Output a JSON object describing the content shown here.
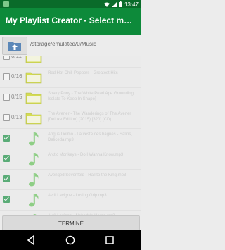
{
  "status_bar": {
    "time": "13:47"
  },
  "app_bar": {
    "title": "My Playlist Creator - Select music..."
  },
  "path_bar": {
    "path": "/storage/emulated/0/Music"
  },
  "rows": [
    {
      "type": "folder",
      "checked": false,
      "count": "0/11",
      "name": "Ghetto Gospel"
    },
    {
      "type": "folder",
      "checked": false,
      "count": "0/16",
      "name": "Red Hot Chili Peppers - Greatest Hits"
    },
    {
      "type": "folder",
      "checked": false,
      "count": "0/15",
      "name": "Shaky Pony - The White Pearl Ape Grounding Isolate To Keep In Shape]"
    },
    {
      "type": "folder",
      "checked": false,
      "count": "0/13",
      "name": "The Avener - The Wanderings of The Avener [Deluxe Edition] (2015) [320] (CD)"
    },
    {
      "type": "music",
      "checked": true,
      "count": "",
      "name": "Angus Delmo - La veste des bagues - Salins, Daliceda.mp3"
    },
    {
      "type": "music",
      "checked": true,
      "count": "",
      "name": "Arctic Monkeys - Do I Wanna Know.mp3"
    },
    {
      "type": "music",
      "checked": true,
      "count": "",
      "name": "Avenged Sevenfold - Hail to the King.mp3"
    },
    {
      "type": "music",
      "checked": true,
      "count": "",
      "name": "Avril Lavigne - Losing Grip.mp3"
    },
    {
      "type": "music",
      "checked": true,
      "count": "",
      "name": "Avril Lavigne - Nobody's Home.mp3"
    }
  ],
  "bottom_button": {
    "label": "TERMINÉ"
  },
  "colors": {
    "primary": "#0d8a3a",
    "primary_dark": "#0a6b2a",
    "folder": "#c8d400",
    "note": "#5cbf4f"
  }
}
